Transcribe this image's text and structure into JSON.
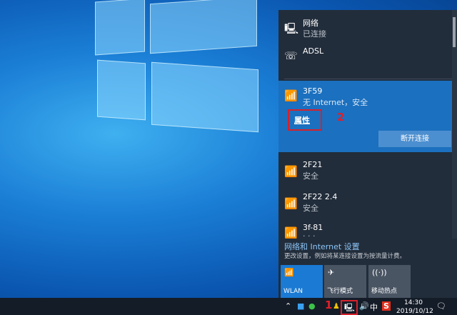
{
  "panel": {
    "wired": {
      "name": "网络",
      "status": "已连接"
    },
    "dialup": {
      "name": "ADSL"
    },
    "selected": {
      "name": "3F59",
      "status": "无 Internet，安全",
      "properties": "属性",
      "disconnect": "断开连接"
    },
    "networks": [
      {
        "name": "2F21",
        "status": "安全"
      },
      {
        "name": "2F22 2.4",
        "status": "安全"
      },
      {
        "name": "3f-81",
        "status": "· · ·"
      }
    ],
    "settings_link": "网络和 Internet 设置",
    "settings_desc": "更改设置，例如将某连接设置为按流量计费。",
    "tiles": [
      {
        "label": "WLAN",
        "active": true
      },
      {
        "label": "飞行模式"
      },
      {
        "label": "移动热点"
      }
    ]
  },
  "annotations": {
    "step1": "1",
    "step2": "2"
  },
  "taskbar": {
    "time": "14:30",
    "date": "2019/10/12",
    "ime": "中"
  },
  "colors": {
    "accent": "#1b70bf",
    "panel": "#222d3b",
    "annotation": "#d8202a"
  }
}
